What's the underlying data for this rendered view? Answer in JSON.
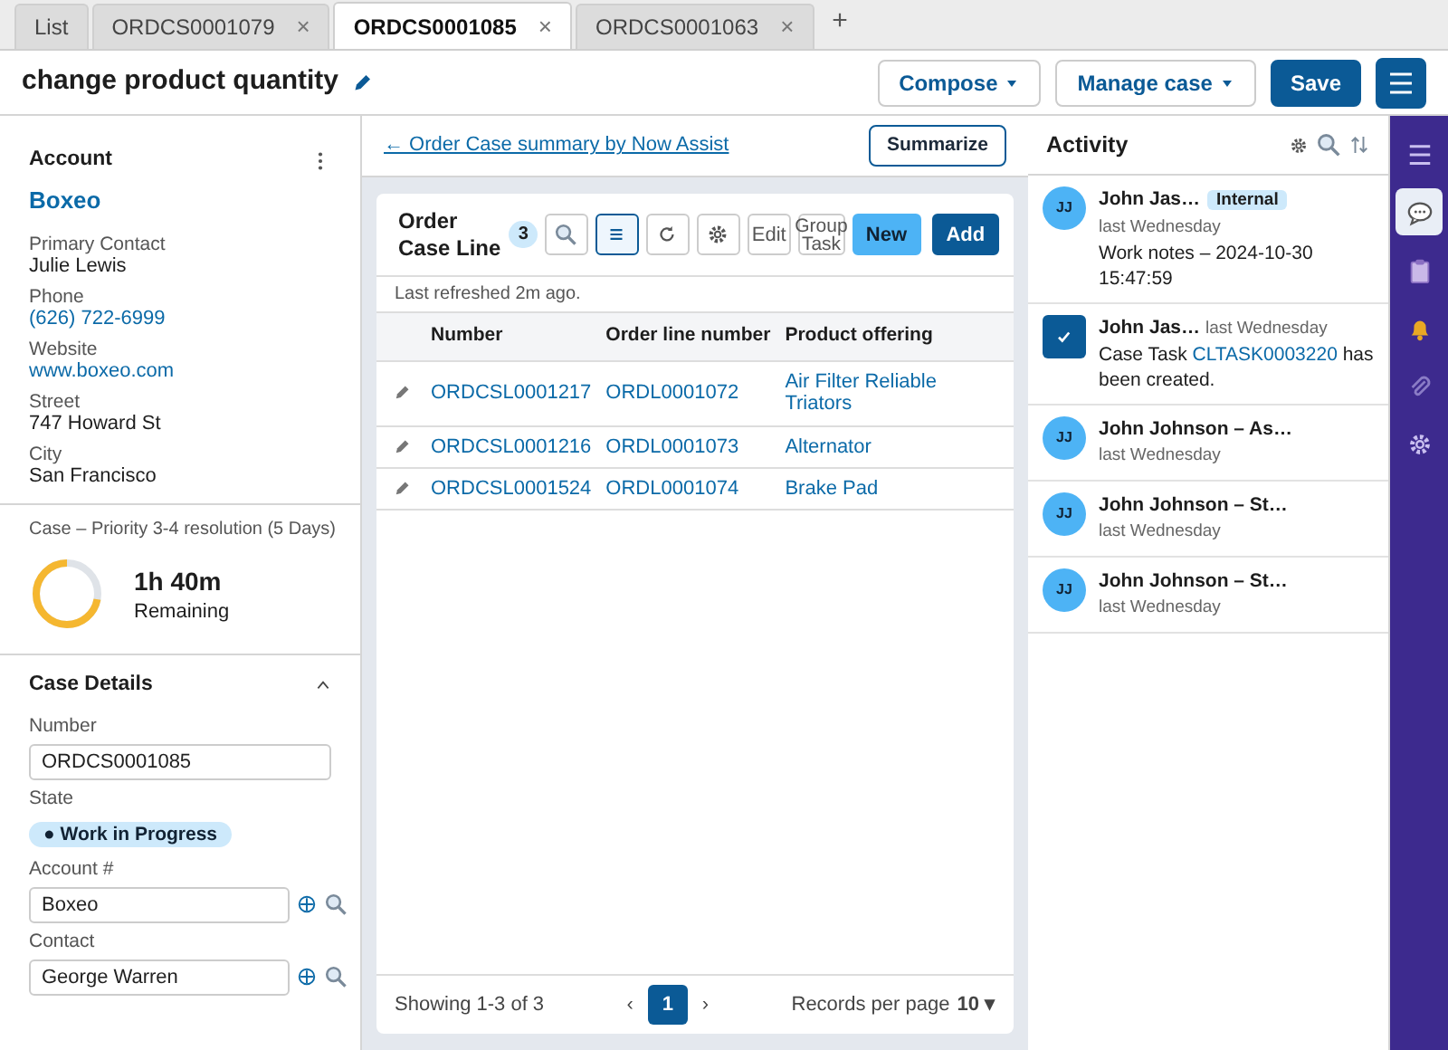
{
  "tabs": [
    {
      "label": "List",
      "selected": false
    },
    {
      "label": "ORDCS0001079",
      "selected": false,
      "close": "×"
    },
    {
      "label": "ORDCS0001085",
      "selected": true,
      "close": "×"
    },
    {
      "label": "ORDCS0001063",
      "selected": false,
      "close": "×"
    }
  ],
  "new_tab": "+",
  "header": {
    "title": "change product quantity",
    "buttons": [
      {
        "label": "Compose",
        "kind": "menu"
      },
      {
        "label": "Manage case",
        "kind": "menu"
      },
      {
        "label": "Save",
        "kind": "primary"
      },
      {
        "kind": "icon"
      }
    ]
  },
  "account": {
    "heading": "Account",
    "name": "Boxeo",
    "fields": [
      {
        "label": "Primary Contact",
        "value": "Julie Lewis",
        "link": false
      },
      {
        "label": "Phone",
        "value": "(626) 722-6999",
        "link": true
      },
      {
        "label": "Website",
        "value": "www.boxeo.com",
        "link": true
      },
      {
        "label": "Street",
        "value": "747 Howard St",
        "link": false
      },
      {
        "label": "City",
        "value": "San Francisco",
        "link": false
      }
    ]
  },
  "sla": {
    "title": "Case – Priority 3-4 resolution (5 Days)",
    "time": "1h 40m",
    "caption": "Remaining",
    "level": 0.72
  },
  "case_details": {
    "heading": "Case Details",
    "expanded": true,
    "fields": [
      {
        "label": "Number",
        "kind": "input",
        "value": "ORDCS0001085"
      },
      {
        "label": "State",
        "kind": "badge",
        "value": "● Work in Progress"
      },
      {
        "label": "Account #",
        "kind": "reference",
        "value": "Boxeo"
      },
      {
        "label": "Contact",
        "kind": "reference",
        "value": "George Warren"
      }
    ]
  },
  "summary_link": "Order Case summary by Now Assist",
  "summary_arrow": "←",
  "summarize": "Summarize",
  "list": {
    "title": "Order Case Line",
    "count": "3",
    "tools": [
      {
        "kind": "search",
        "selected": false
      },
      {
        "kind": "list",
        "selected": true
      },
      {
        "kind": "refresh",
        "selected": false
      },
      {
        "kind": "settings",
        "selected": false
      },
      {
        "kind": "text",
        "label": "Edit",
        "selected": false
      },
      {
        "kind": "text",
        "label": "Group Task",
        "selected": false
      },
      {
        "kind": "new",
        "label": "New"
      },
      {
        "kind": "add",
        "label": "Add"
      }
    ],
    "refreshed": "Last refreshed 2m ago.",
    "columns": [
      "Number",
      "Order line number",
      "Product offering"
    ],
    "rows": [
      [
        "ORDCSL0001217",
        "ORDL0001072",
        "Air Filter Reliable Triators"
      ],
      [
        "ORDCSL0001216",
        "ORDL0001073",
        "Alternator"
      ],
      [
        "ORDCSL0001524",
        "ORDL0001074",
        "Brake Pad"
      ]
    ],
    "showing": "Showing 1-3 of 3",
    "prev": "‹",
    "next": "›",
    "pages": [
      {
        "label": "1",
        "selected": true
      }
    ],
    "per_page_label": "Records per page",
    "per_page": "10 ▾"
  },
  "activity": {
    "title": "Activity",
    "items": [
      {
        "kind": "note",
        "initials": "JJ",
        "author": "John Jas…",
        "tag": "Internal",
        "when": "last Wednesday",
        "text": "Work notes – 2024-10-30 15:47:59"
      },
      {
        "kind": "task",
        "author": "John Jas…",
        "when": "last Wednesday",
        "text_before": "Case Task ",
        "link": "CLTASK0003220",
        "text_after": " has been created."
      },
      {
        "kind": "note",
        "initials": "JJ",
        "author": "John Johnson – As…",
        "when": "last Wednesday"
      },
      {
        "kind": "note",
        "initials": "JJ",
        "author": "John Johnson – St…",
        "when": "last Wednesday"
      },
      {
        "kind": "note",
        "initials": "JJ",
        "author": "John Johnson – St…",
        "when": "last Wednesday"
      }
    ]
  },
  "rail": [
    {
      "selected": false
    },
    {
      "selected": true
    },
    {
      "selected": false
    },
    {
      "selected": false
    },
    {
      "selected": false
    },
    {
      "selected": false
    }
  ]
}
